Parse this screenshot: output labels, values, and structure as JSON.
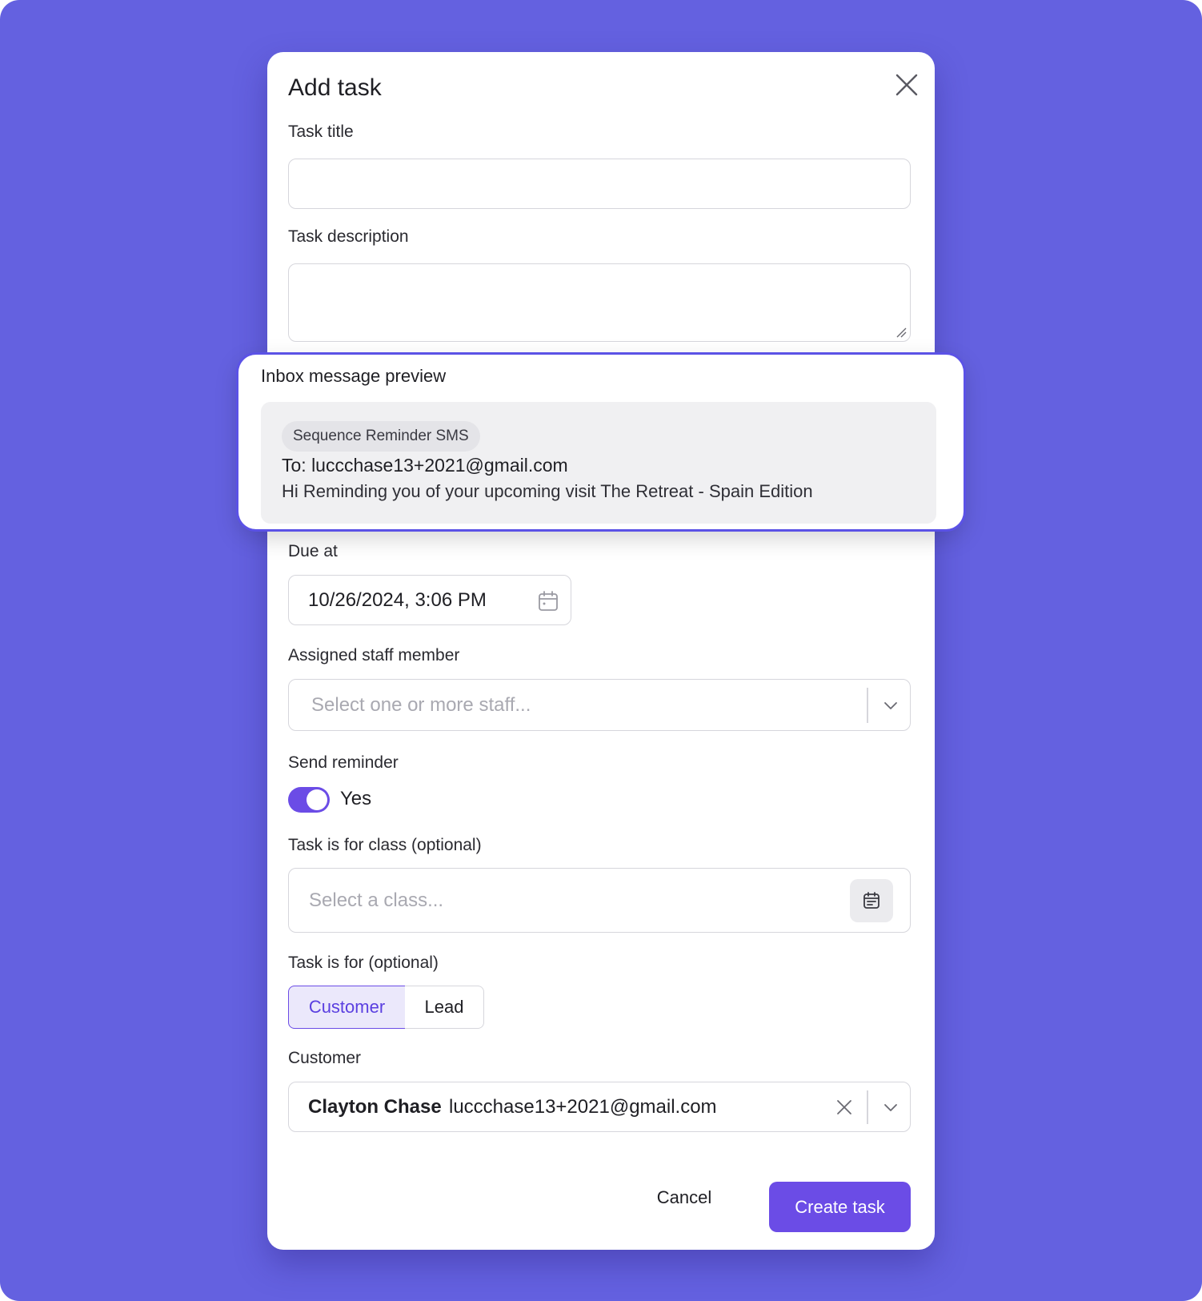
{
  "modal": {
    "title": "Add task",
    "close_icon": "close-icon"
  },
  "task_title": {
    "label": "Task title",
    "value": ""
  },
  "task_description": {
    "label": "Task description",
    "value": ""
  },
  "preview": {
    "title": "Inbox message preview",
    "chip": "Sequence Reminder SMS",
    "to": "To: luccchase13+2021@gmail.com",
    "body": "Hi Reminding you of your upcoming visit The Retreat - Spain Edition"
  },
  "due_at": {
    "label": "Due at",
    "value": "10/26/2024, 3:06 PM",
    "icon": "calendar-icon"
  },
  "staff": {
    "label": "Assigned staff member",
    "placeholder": "Select one or more staff...",
    "icon": "chevron-down-icon"
  },
  "reminder": {
    "label": "Send reminder",
    "toggle_label": "Yes",
    "enabled": true
  },
  "class_select": {
    "label": "Task is for class (optional)",
    "placeholder": "Select a class...",
    "icon": "calendar-icon"
  },
  "task_for": {
    "label": "Task is for (optional)",
    "options": [
      "Customer",
      "Lead"
    ],
    "selected": "Customer"
  },
  "customer": {
    "label": "Customer",
    "name": "Clayton Chase",
    "email": "luccchase13+2021@gmail.com"
  },
  "actions": {
    "cancel": "Cancel",
    "create": "Create task"
  },
  "colors": {
    "background": "#6461e0",
    "accent": "#6b4ce6",
    "accent_light": "#ebe8fb"
  }
}
